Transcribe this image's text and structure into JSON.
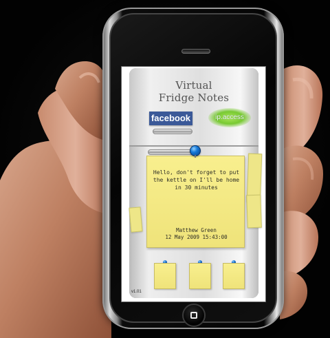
{
  "app": {
    "title_line_1": "Virtual",
    "title_line_2": "Fridge Notes",
    "version": "v1.01"
  },
  "logos": {
    "facebook": "facebook",
    "ipaccess_prefix": "ip",
    "ipaccess_suffix": ".access"
  },
  "note": {
    "message": "Hello, don't forget to put the kettle on I'll be home in 30 minutes",
    "sender": "Matthew Green",
    "date": "12 May 2009 15:43:00"
  },
  "colors": {
    "facebook_blue": "#3b5998",
    "note_yellow": "#f8ef8e",
    "pin_blue": "#1679d8",
    "ipaccess_green": "#78c932"
  },
  "icons": {
    "facebook": "facebook-logo",
    "ipaccess": "ipaccess-logo",
    "pin": "pin-icon",
    "home": "home-button-icon"
  }
}
